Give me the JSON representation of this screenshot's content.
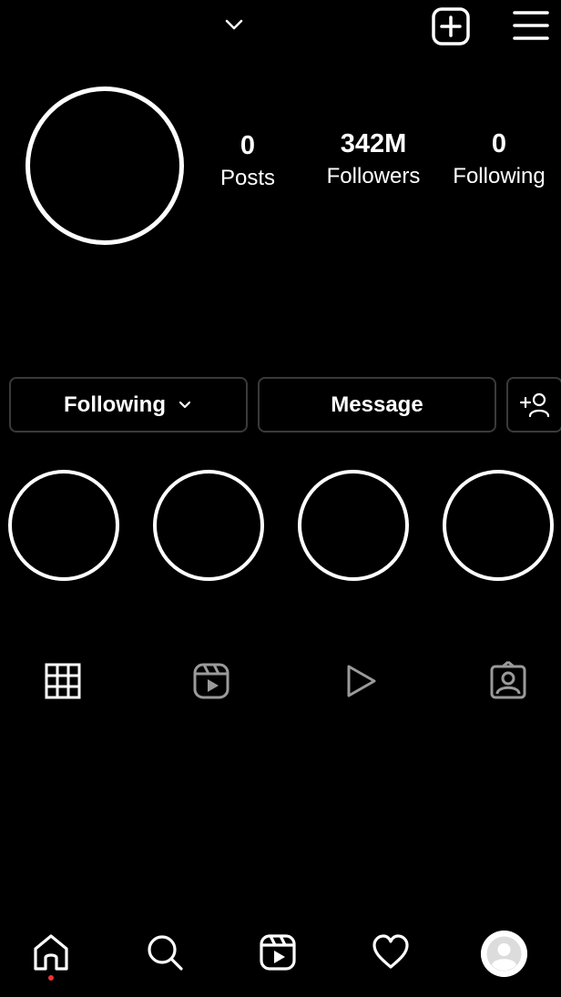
{
  "profile": {
    "stats": {
      "posts": {
        "value": "0",
        "label": "Posts"
      },
      "followers": {
        "value": "342M",
        "label": "Followers"
      },
      "following": {
        "value": "0",
        "label": "Following"
      }
    }
  },
  "actions": {
    "following_label": "Following",
    "message_label": "Message"
  },
  "icons": {
    "top": [
      "chevron-down-icon",
      "add-post-icon",
      "menu-icon"
    ],
    "tabs": [
      "grid-icon",
      "reels-icon",
      "video-play-icon",
      "tagged-icon"
    ],
    "nav": [
      "home-icon",
      "search-icon",
      "reels-icon",
      "heart-icon",
      "profile-avatar"
    ]
  },
  "colors": {
    "background": "#000000",
    "foreground": "#ffffff",
    "inactive_icon": "#9a9a9a",
    "button_border": "#3a3a3a",
    "notification_dot": "#e33333"
  }
}
